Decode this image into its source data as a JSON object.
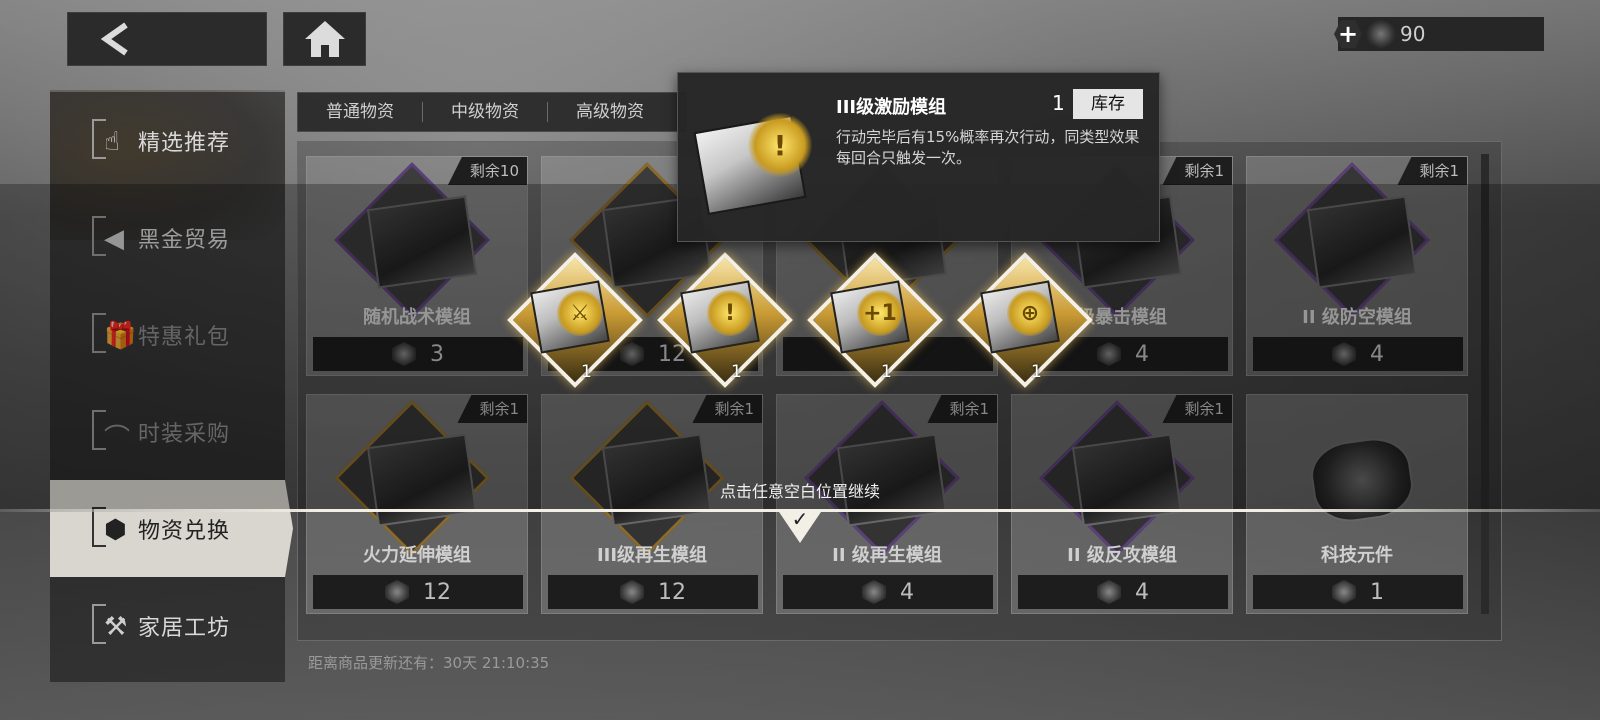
{
  "currency": {
    "value": "90"
  },
  "sidebar": {
    "items": [
      {
        "label": "精选推荐",
        "glyph": "☝"
      },
      {
        "label": "黑金贸易",
        "glyph": "◀"
      },
      {
        "label": "特惠礼包",
        "glyph": "🎁"
      },
      {
        "label": "时装采购",
        "glyph": "⌒"
      },
      {
        "label": "物资兑换",
        "glyph": "⬢"
      },
      {
        "label": "家居工坊",
        "glyph": "⚒"
      }
    ]
  },
  "tabs": [
    "普通物资",
    "中级物资",
    "高级物资"
  ],
  "goods": [
    {
      "remain": "剩余10",
      "name": "随机战术模组",
      "price": "3"
    },
    {
      "remain": "",
      "name": "",
      "price": "12"
    },
    {
      "remain": "",
      "name": "",
      "price": ""
    },
    {
      "remain": "剩余1",
      "name": "级暴击模组",
      "price": "4"
    },
    {
      "remain": "剩余1",
      "name": "II 级防空模组",
      "price": "4"
    },
    {
      "remain": "剩余1",
      "name": "火力延伸模组",
      "price": "12"
    },
    {
      "remain": "剩余1",
      "name": "III级再生模组",
      "price": "12"
    },
    {
      "remain": "剩余1",
      "name": "II 级再生模组",
      "price": "4"
    },
    {
      "remain": "剩余1",
      "name": "II 级反攻模组",
      "price": "4"
    },
    {
      "remain": "",
      "name": "科技元件",
      "price": "1"
    }
  ],
  "refresh_text": "距离商品更新还有：30天 21:10:35",
  "rewards": [
    {
      "qty": "1",
      "emblem": "⚔"
    },
    {
      "qty": "1",
      "emblem": "!"
    },
    {
      "qty": "1",
      "emblem": "+1"
    },
    {
      "qty": "1",
      "emblem": "⊕"
    }
  ],
  "tooltip": {
    "title": "III级激励模组",
    "qty": "1",
    "store_label": "库存",
    "desc": "行动完毕后有15%概率再次行动，同类型效果每回合只触发一次。"
  },
  "continue_text": "点击任意空白位置继续"
}
